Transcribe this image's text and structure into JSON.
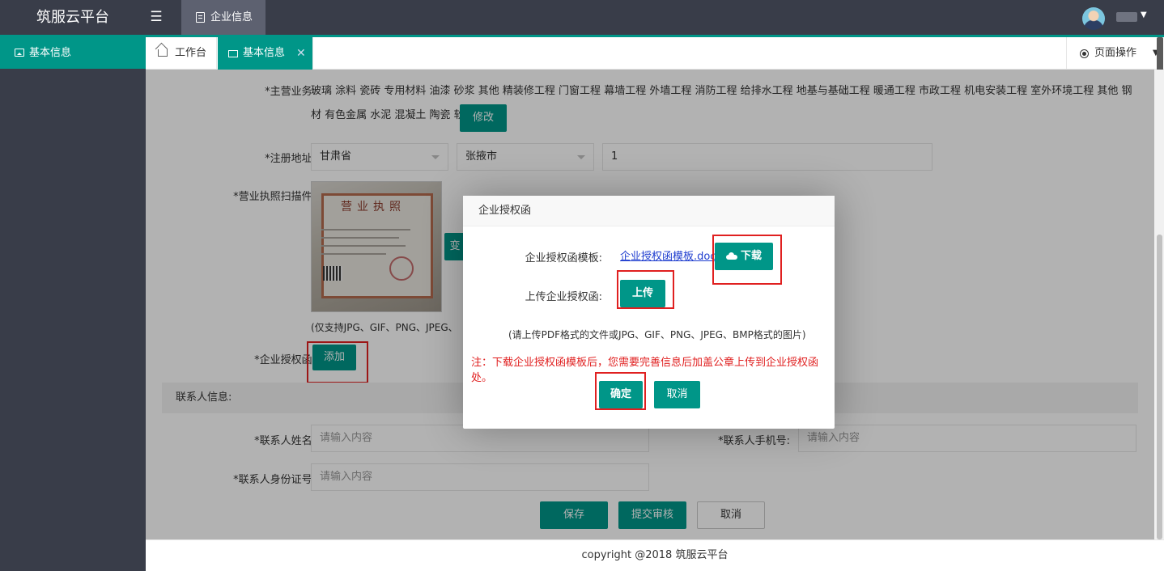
{
  "header": {
    "brand": "筑服云平台",
    "menu_icon": "menu-icon",
    "active_module": "企业信息"
  },
  "sidebar": {
    "items": [
      {
        "label": "基本信息",
        "icon": "image-icon",
        "active": true
      }
    ]
  },
  "tabs": {
    "home_label": "工作台",
    "active_label": "基本信息",
    "close_glyph": "✕",
    "page_ops_label": "页面操作"
  },
  "form": {
    "business_label": "*主营业务:",
    "business_value": "玻璃 涂料 瓷砖 专用材料 油漆 砂浆 其他 精装修工程 门窗工程 幕墙工程 外墙工程 消防工程 给排水工程 地基与基础工程 暖通工程 市政工程 机电安装工程 室外环境工程 其他 钢材 有色金属 水泥 混凝土 陶瓷 软件服务",
    "modify_button": "修改",
    "address_label": "*注册地址:",
    "province": "甘肃省",
    "city": "张掖市",
    "address_detail": "1",
    "license_label": "*营业执照扫描件:",
    "license_image_title": "营业执照",
    "license_hint": "(仅支持JPG、GIF、PNG、JPEG、",
    "change_button_partial": "变",
    "auth_letter_label": "*企业授权函:",
    "add_button": "添加",
    "contact_section": "联系人信息:",
    "contact_name_label": "*联系人姓名:",
    "contact_name_placeholder": "请输入内容",
    "contact_phone_label": "*联系人手机号:",
    "contact_phone_placeholder": "请输入内容",
    "contact_id_label": "*联系人身份证号:",
    "contact_id_placeholder": "请输入内容",
    "save_button": "保存",
    "submit_button": "提交审核",
    "cancel_button": "取消"
  },
  "dialog": {
    "title": "企业授权函",
    "template_label": "企业授权函模板:",
    "template_link": "企业授权函模板.doc",
    "download_button": "下载",
    "upload_label": "上传企业授权函:",
    "upload_button": "上传",
    "hint": "(请上传PDF格式的文件或JPG、GIF、PNG、JPEG、BMP格式的图片)",
    "note": "注：下载企业授权函模板后，您需要完善信息后加盖公章上传到企业授权函处。",
    "confirm_button": "确定",
    "cancel_button": "取消"
  },
  "footer": {
    "copyright": "copyright @2018 筑服云平台"
  },
  "colors": {
    "primary": "#009688",
    "header_bg": "#393d49",
    "highlight_red": "#e02020"
  }
}
